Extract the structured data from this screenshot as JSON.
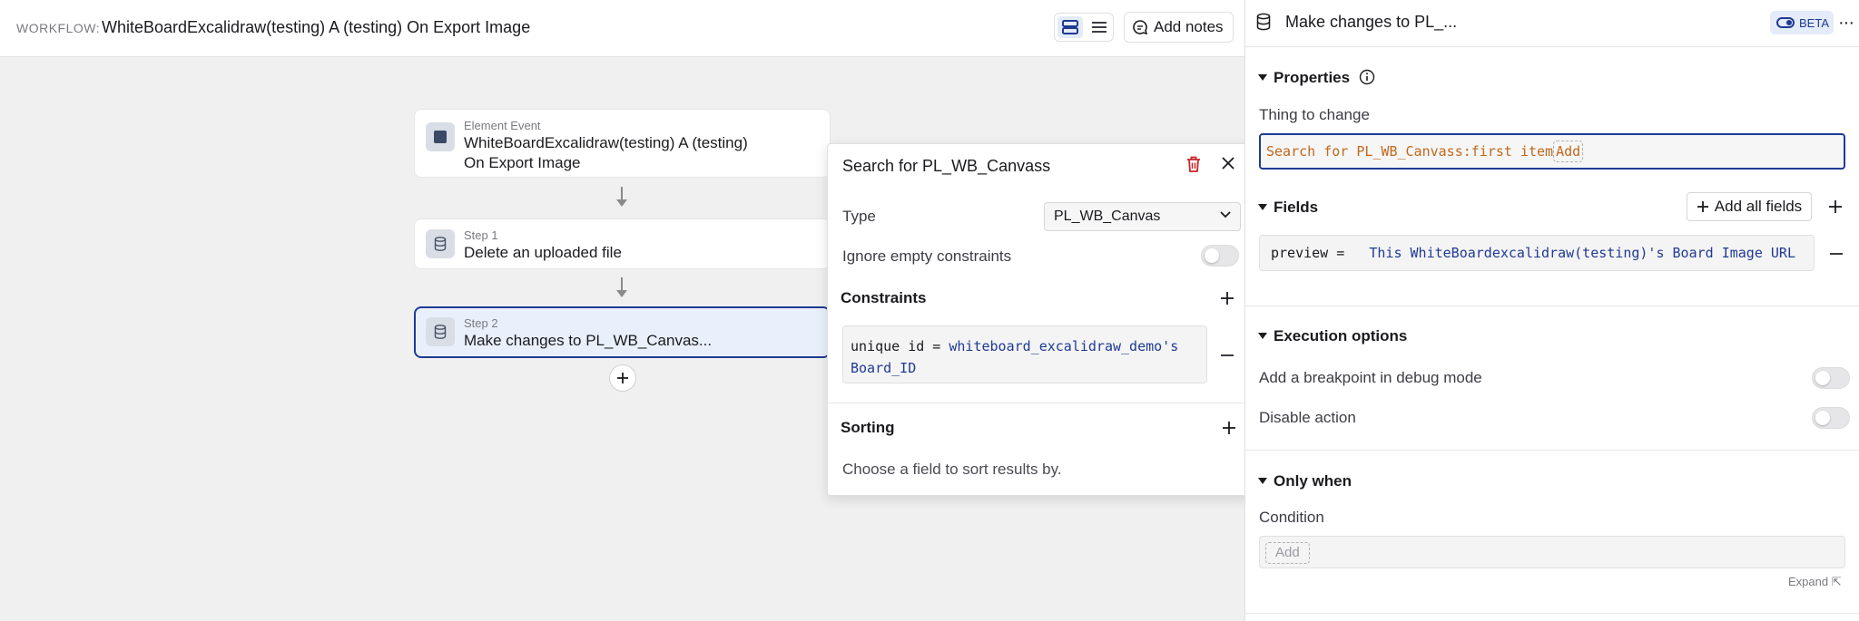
{
  "header": {
    "workflow_label": "WORKFLOW:",
    "workflow_name": "WhiteBoardExcalidraw(testing) A (testing)  On Export Image",
    "add_notes_label": "Add notes"
  },
  "nodes": [
    {
      "caption": "Element Event",
      "title_line1": "WhiteBoardExcalidraw(testing) A (testing)",
      "title_line2": "On Export Image"
    },
    {
      "caption": "Step 1",
      "title": "Delete an uploaded file"
    },
    {
      "caption": "Step 2",
      "title": "Make changes to PL_WB_Canvas..."
    }
  ],
  "search_popover": {
    "title": "Search for PL_WB_Canvass",
    "type_label": "Type",
    "type_value": "PL_WB_Canvas",
    "ignore_empty_label": "Ignore empty constraints",
    "constraints_title": "Constraints",
    "constraint": {
      "key": "unique id =",
      "value_line1": "whiteboard_excalidraw_demo's",
      "value_line2": "Board_ID"
    },
    "sorting_title": "Sorting",
    "sorting_hint": "Choose a field to sort results by."
  },
  "right_panel": {
    "title": "Make changes to PL_...",
    "beta_label": "BETA",
    "more_label": "···",
    "properties_title": "Properties",
    "thing_to_change_label": "Thing to change",
    "thing_to_change_value": "Search for PL_WB_Canvass:first item",
    "add_label": "Add",
    "fields_title": "Fields",
    "add_all_fields_label": "Add all fields",
    "field": {
      "key": "preview =",
      "value": "This WhiteBoardexcalidraw(testing)'s Board Image URL"
    },
    "execution_title": "Execution options",
    "breakpoint_label": "Add a breakpoint in debug mode",
    "disable_label": "Disable action",
    "only_when_title": "Only when",
    "condition_label": "Condition",
    "condition_add": "Add",
    "expand_label": "Expand ⇱"
  },
  "colors": {
    "accent": "#1f3a93",
    "danger": "#c62828",
    "expression": "#c2681a"
  }
}
